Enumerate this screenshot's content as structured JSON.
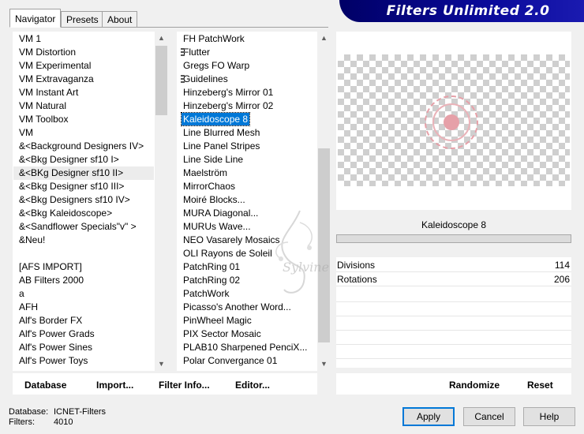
{
  "window": {
    "logo_text": "Filters Unlimited 2.0"
  },
  "tabs": [
    {
      "label": "Navigator",
      "active": true
    },
    {
      "label": "Presets",
      "active": false
    },
    {
      "label": "About",
      "active": false
    }
  ],
  "categories": [
    "VM 1",
    "VM Distortion",
    "VM Experimental",
    "VM Extravaganza",
    "VM Instant Art",
    "VM Natural",
    "VM Toolbox",
    "VM",
    "&<Background Designers IV>",
    "&<Bkg Designer sf10 I>",
    "&<BKg Designer sf10 II>",
    "&<Bkg Designer sf10 III>",
    "&<Bkg Designers sf10 IV>",
    "&<Bkg Kaleidoscope>",
    "&<Sandflower Specials\"v\" >",
    "&Neu!",
    "",
    "[AFS IMPORT]",
    "AB Filters 2000",
    "a",
    "AFH",
    "Alf's Border FX",
    "Alf's Power Grads",
    "Alf's Power Sines",
    "Alf's Power Toys"
  ],
  "categories_highlighted_index": 10,
  "filters": [
    {
      "label": "FH PatchWork",
      "marker": false
    },
    {
      "label": "Flutter",
      "marker": true
    },
    {
      "label": "Gregs FO Warp",
      "marker": false
    },
    {
      "label": "Guidelines",
      "marker": true
    },
    {
      "label": "Hinzeberg's Mirror 01",
      "marker": false
    },
    {
      "label": "Hinzeberg's Mirror 02",
      "marker": false
    },
    {
      "label": "Kaleidoscope 8",
      "marker": false
    },
    {
      "label": "Line Blurred Mesh",
      "marker": false
    },
    {
      "label": "Line Panel Stripes",
      "marker": false
    },
    {
      "label": "Line Side Line",
      "marker": false
    },
    {
      "label": "Maelström",
      "marker": false
    },
    {
      "label": "MirrorChaos",
      "marker": false
    },
    {
      "label": "Moiré Blocks...",
      "marker": false
    },
    {
      "label": "MURA Diagonal...",
      "marker": false
    },
    {
      "label": "MURUs Wave...",
      "marker": false
    },
    {
      "label": "NEO Vasarely Mosaics",
      "marker": false
    },
    {
      "label": "OLI Rayons de Soleil",
      "marker": false
    },
    {
      "label": "PatchRing 01",
      "marker": false
    },
    {
      "label": "PatchRing 02",
      "marker": false
    },
    {
      "label": "PatchWork",
      "marker": false
    },
    {
      "label": "Picasso's Another Word...",
      "marker": false
    },
    {
      "label": "PinWheel Magic",
      "marker": false
    },
    {
      "label": "PIX Sector Mosaic",
      "marker": false
    },
    {
      "label": "PLAB10 Sharpened PenciX...",
      "marker": false
    },
    {
      "label": "Polar Convergance 01",
      "marker": false
    }
  ],
  "filters_selected_index": 6,
  "preview": {
    "filter_name": "Kaleidoscope 8",
    "accent_color": "#e6a0a8"
  },
  "parameters": [
    {
      "label": "Divisions",
      "value": "114"
    },
    {
      "label": "Rotations",
      "value": "206"
    }
  ],
  "bottom_left_buttons": {
    "database": "Database",
    "import": "Import...",
    "filter_info": "Filter Info...",
    "editor": "Editor..."
  },
  "bottom_right_buttons": {
    "randomize": "Randomize",
    "reset": "Reset"
  },
  "status": {
    "database_label": "Database:",
    "database_value": "ICNET-Filters",
    "filters_label": "Filters:",
    "filters_value": "4010"
  },
  "dialog_buttons": {
    "apply": "Apply",
    "cancel": "Cancel",
    "help": "Help"
  },
  "watermark_text": "Sylvine"
}
